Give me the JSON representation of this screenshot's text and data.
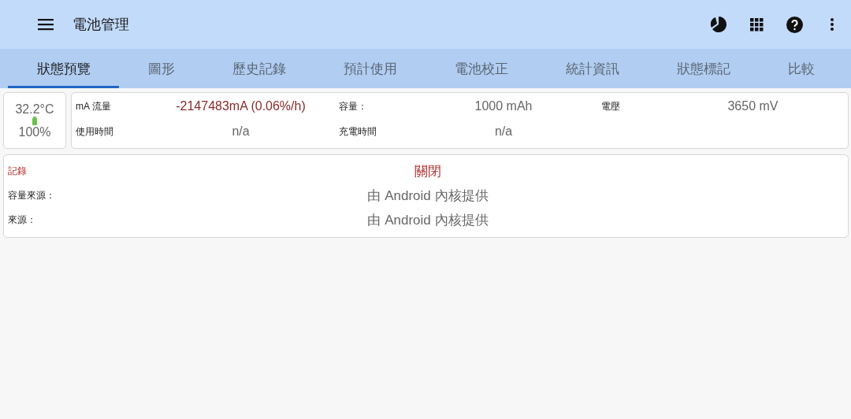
{
  "app_bar": {
    "title": "電池管理"
  },
  "tabs": [
    {
      "label": "狀態預覽",
      "selected": true
    },
    {
      "label": "圖形",
      "selected": false
    },
    {
      "label": "歷史記錄",
      "selected": false
    },
    {
      "label": "預計使用",
      "selected": false
    },
    {
      "label": "電池校正",
      "selected": false
    },
    {
      "label": "統計資訊",
      "selected": false
    },
    {
      "label": "狀態標記",
      "selected": false
    },
    {
      "label": "比較",
      "selected": false
    }
  ],
  "battery_card": {
    "temperature": "32.2°C",
    "percent": "100%"
  },
  "info_rows": [
    [
      {
        "label": "mA 流量",
        "value": "-2147483mA (0.06%/h)",
        "highlight": true
      },
      {
        "label": "容量：",
        "value": "1000 mAh",
        "highlight": false
      },
      {
        "label": "電壓",
        "value": "3650 mV",
        "highlight": false
      }
    ],
    [
      {
        "label": "使用時間",
        "value": "n/a",
        "highlight": false
      },
      {
        "label": "充電時間",
        "value": "n/a",
        "highlight": false
      }
    ]
  ],
  "source_rows": [
    {
      "kind": "status",
      "label": "記錄",
      "value": "關閉"
    },
    {
      "kind": "info",
      "label": "容量來源：",
      "value": "由 Android 內核提供"
    },
    {
      "kind": "info",
      "label": "來源：",
      "value": "由 Android 內核提供"
    }
  ]
}
